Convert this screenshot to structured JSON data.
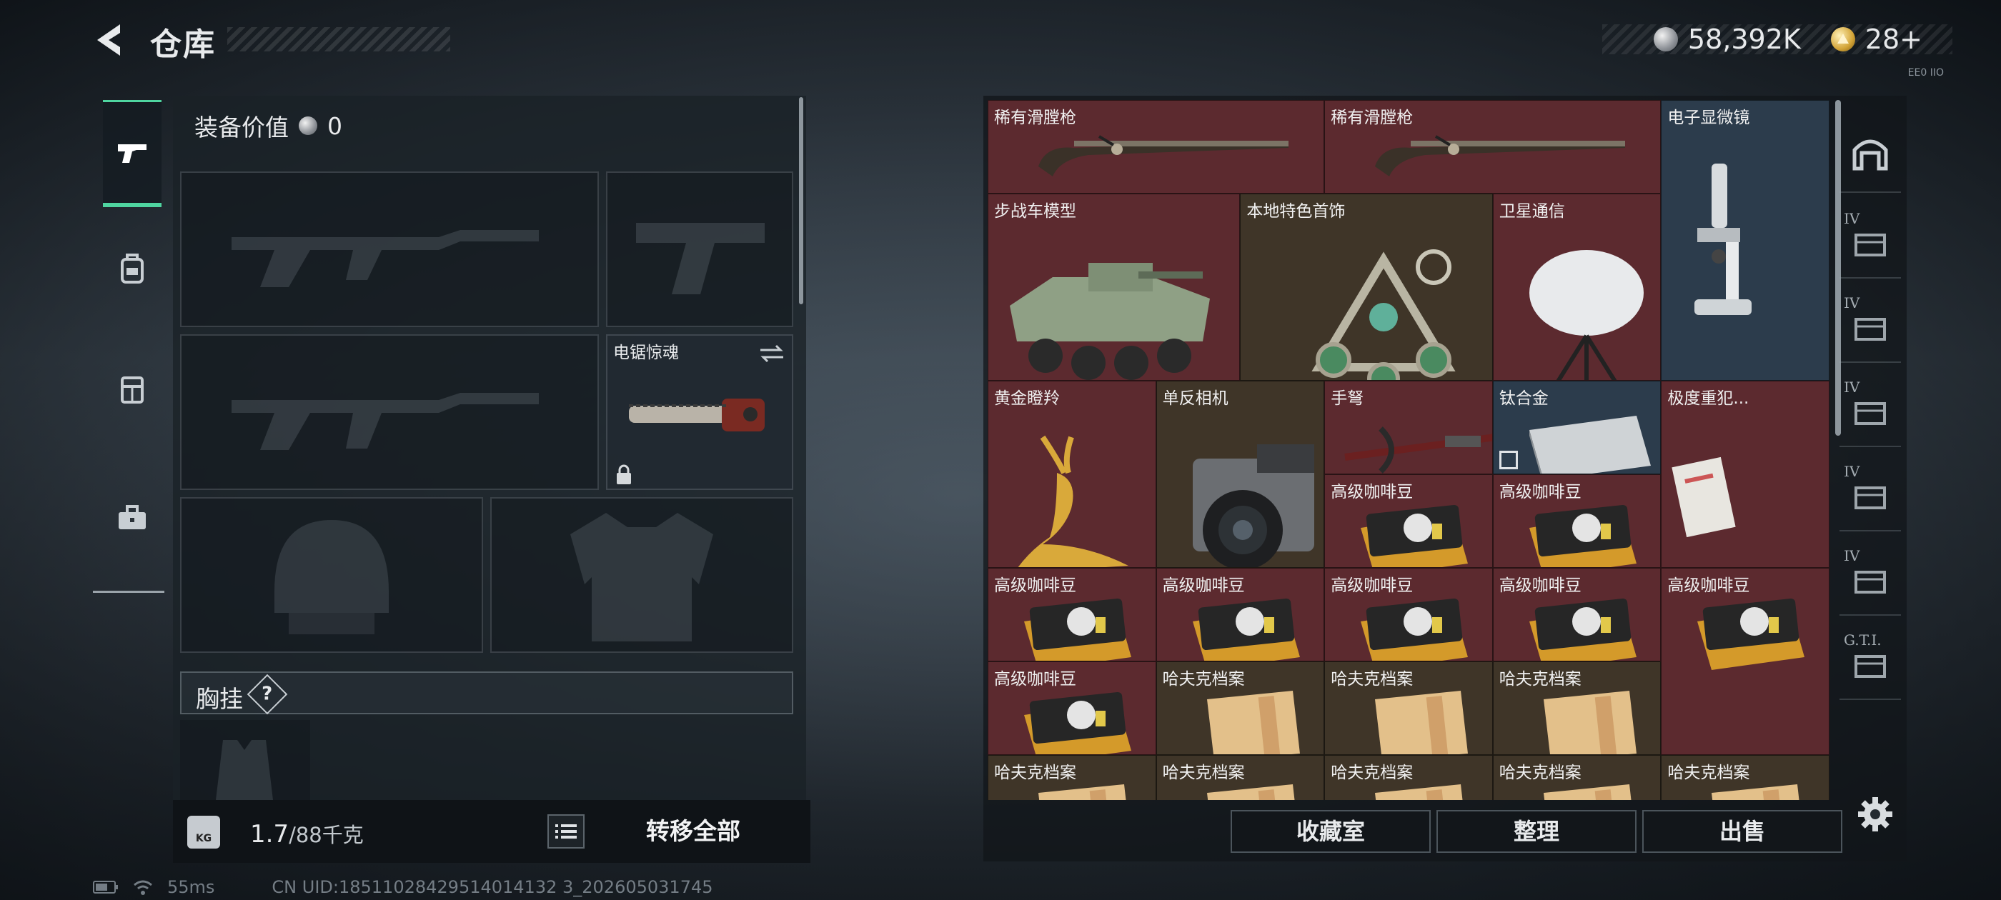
{
  "header": {
    "title": "仓库",
    "currency": [
      {
        "icon": "silver-coin-icon",
        "value": "58,392K"
      },
      {
        "icon": "gold-coin-icon",
        "value": "28+"
      }
    ],
    "mini_code": "EE0 IIO"
  },
  "categories": [
    {
      "icon": "pistol-icon",
      "active": true
    },
    {
      "icon": "backpack-icon",
      "active": false
    },
    {
      "icon": "chest-rig-icon",
      "active": false
    },
    {
      "icon": "toolbox-icon",
      "active": false
    }
  ],
  "loadout": {
    "equip_value_label": "装备价值",
    "equip_value": "0",
    "melee_slot_name": "电锯惊魂",
    "chest_label": "胸挂",
    "chest_help": "?",
    "weight_current": "1.7",
    "weight_limit": "/88千克",
    "weight_icon_text": "KG",
    "transfer_all": "转移全部"
  },
  "stash": {
    "items": [
      {
        "name": "稀有滑膛枪",
        "bg": "red",
        "icon": "musket-icon"
      },
      {
        "name": "稀有滑膛枪",
        "bg": "red",
        "icon": "musket-icon"
      },
      {
        "name": "电子显微镜",
        "bg": "blue",
        "icon": "microscope-icon"
      },
      {
        "name": "步战车模型",
        "bg": "red",
        "icon": "ifv-model-icon"
      },
      {
        "name": "本地特色首饰",
        "bg": "brown",
        "icon": "jewelry-icon"
      },
      {
        "name": "卫星通信",
        "bg": "red",
        "icon": "satellite-dish-icon"
      },
      {
        "name": "黄金瞪羚",
        "bg": "red",
        "icon": "gold-gazelle-icon"
      },
      {
        "name": "单反相机",
        "bg": "brown",
        "icon": "camera-icon"
      },
      {
        "name": "手弩",
        "bg": "red",
        "icon": "crossbow-icon"
      },
      {
        "name": "钛合金",
        "bg": "blue",
        "icon": "titanium-ingot-icon"
      },
      {
        "name": "极度重犯...",
        "bg": "red",
        "icon": "document-icon"
      },
      {
        "name": "高级咖啡豆",
        "bg": "red",
        "icon": "coffee-bag-icon"
      },
      {
        "name": "高级咖啡豆",
        "bg": "red",
        "icon": "coffee-bag-icon"
      },
      {
        "name": "高级咖啡豆",
        "bg": "red",
        "icon": "coffee-bag-icon"
      },
      {
        "name": "高级咖啡豆",
        "bg": "red",
        "icon": "coffee-bag-icon"
      },
      {
        "name": "高级咖啡豆",
        "bg": "red",
        "icon": "coffee-bag-icon"
      },
      {
        "name": "高级咖啡豆",
        "bg": "red",
        "icon": "coffee-bag-icon"
      },
      {
        "name": "高级咖啡豆",
        "bg": "red",
        "icon": "coffee-bag-icon"
      },
      {
        "name": "高级咖啡豆",
        "bg": "red",
        "icon": "coffee-bag-icon"
      },
      {
        "name": "哈夫克档案",
        "bg": "brown",
        "icon": "archive-folder-icon"
      },
      {
        "name": "哈夫克档案",
        "bg": "brown",
        "icon": "archive-folder-icon"
      },
      {
        "name": "哈夫克档案",
        "bg": "brown",
        "icon": "archive-folder-icon"
      },
      {
        "name": "哈夫克档案",
        "bg": "brown",
        "icon": "archive-folder-icon"
      },
      {
        "name": "哈夫克档案",
        "bg": "brown",
        "icon": "archive-folder-icon"
      },
      {
        "name": "哈夫克档案",
        "bg": "brown",
        "icon": "archive-folder-icon"
      },
      {
        "name": "哈夫克档案",
        "bg": "brown",
        "icon": "archive-folder-icon"
      },
      {
        "name": "哈夫克档案",
        "bg": "brown",
        "icon": "archive-folder-icon"
      }
    ],
    "side_tags": [
      "IV",
      "IV",
      "IV",
      "IV",
      "IV",
      "G.T.I."
    ],
    "buttons": {
      "collection": "收藏室",
      "sort": "整理",
      "sell": "出售"
    }
  },
  "status": {
    "ping": "55ms",
    "uid": "CN UID:18511028429514014132 3_202605031745"
  },
  "colors": {
    "accent": "#4fd5a0",
    "cell_red": "#5c2a2f",
    "cell_brown": "#3f3528",
    "cell_blue": "#2c3c4c"
  }
}
